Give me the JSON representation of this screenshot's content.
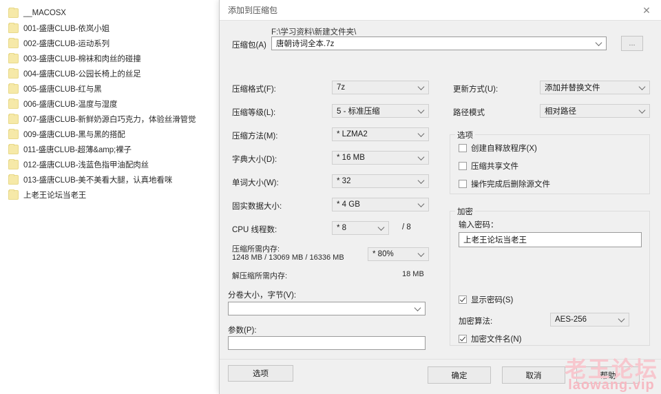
{
  "explorer": {
    "files": [
      {
        "name": "__MACOSX"
      },
      {
        "name": "001-盛唐CLUB-依岚小姐"
      },
      {
        "name": "002-盛唐CLUB-运动系列"
      },
      {
        "name": "003-盛唐CLUB-棉袜和肉丝的碰撞"
      },
      {
        "name": "004-盛唐CLUB-公园长椅上的丝足"
      },
      {
        "name": "005-盛唐CLUB-红与黑"
      },
      {
        "name": "006-盛唐CLUB-温度与湿度"
      },
      {
        "name": "007-盛唐CLUB-新鲜奶源白巧克力，体验丝滑管觉"
      },
      {
        "name": "009-盛唐CLUB-黑与黑的搭配"
      },
      {
        "name": "011-盛唐CLUB-超薄&amp;裸子"
      },
      {
        "name": "012-盛唐CLUB-浅蓝色指甲油配肉丝"
      },
      {
        "name": "013-盛唐CLUB-美不美看大腿，认真地看咪"
      },
      {
        "name": "上老王论坛当老王"
      }
    ]
  },
  "dialog": {
    "title": "添加到压缩包",
    "close_icon": "✕",
    "archive": {
      "label": "压缩包(A)",
      "path": "F:\\学习资料\\新建文件夹\\",
      "value": "唐朝诗词全本.7z",
      "browse_label": "..."
    },
    "left_fields": [
      {
        "label": "压缩格式(F):",
        "value": "7z"
      },
      {
        "label": "压缩等级(L):",
        "value": "5 - 标准压缩"
      },
      {
        "label": "压缩方法(M):",
        "value": "*  LZMA2"
      },
      {
        "label": "字典大小(D):",
        "value": "*  16 MB"
      },
      {
        "label": "单词大小(W):",
        "value": "*  32"
      },
      {
        "label": "固实数据大小:",
        "value": "*  4 GB"
      }
    ],
    "cpu": {
      "label": "CPU 线程数:",
      "value": "*  8",
      "total": "/ 8"
    },
    "memory": {
      "compress_label": "压缩所需内存:",
      "compress_value": "1248 MB / 13069 MB / 16336 MB",
      "percent": "*  80%",
      "decompress_label": "解压缩所需内存:",
      "decompress_value": "18 MB"
    },
    "volume": {
      "label": "分卷大小，字节(V):",
      "value": ""
    },
    "params": {
      "label": "参数(P):",
      "value": ""
    },
    "options_button": "选项",
    "update_mode": {
      "label": "更新方式(U):",
      "value": "添加并替换文件"
    },
    "path_mode": {
      "label": "路径模式",
      "value": "相对路径"
    },
    "options_group": {
      "title": "选项",
      "items": [
        {
          "label": "创建自释放程序(X)",
          "checked": false
        },
        {
          "label": "压缩共享文件",
          "checked": false
        },
        {
          "label": "操作完成后删除源文件",
          "checked": false
        }
      ]
    },
    "encryption": {
      "title": "加密",
      "password_label": "输入密码：",
      "password_value": "上老王论坛当老王",
      "show_password": {
        "label": "显示密码(S)",
        "checked": true
      },
      "algo_label": "加密算法:",
      "algo_value": "AES-256",
      "encrypt_names": {
        "label": "加密文件名(N)",
        "checked": true
      }
    },
    "buttons": {
      "ok": "确定",
      "cancel": "取消",
      "help": "帮助"
    }
  },
  "watermark": {
    "cn": "老王论坛",
    "en": "laowang.vip",
    "color": "#f7c7ce"
  }
}
